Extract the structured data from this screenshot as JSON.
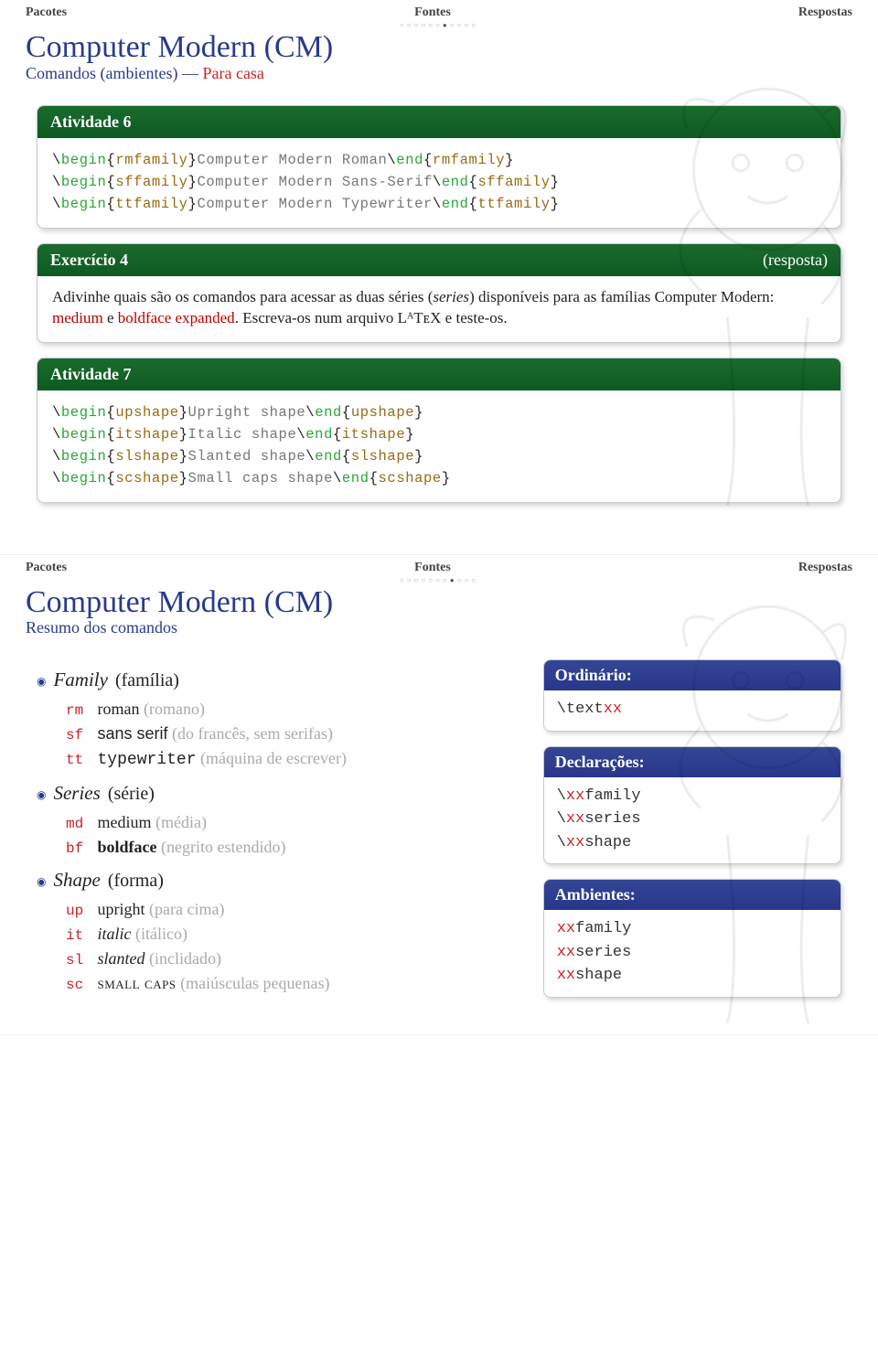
{
  "nav": {
    "left": "Pacotes",
    "center": "Fontes",
    "right": "Respostas"
  },
  "slide1": {
    "progress_index": 6,
    "progress_total": 11,
    "title": "Computer Modern (CM)",
    "subtitle_a": "Comandos (ambientes) — ",
    "subtitle_b": "Para casa",
    "box1": {
      "head": "Atividade 6",
      "lines": [
        {
          "pre": "\\",
          "kw": "begin",
          "env": "rmfamily",
          "mid": "Computer Modern Roman",
          "post_kw": "end",
          "post_env": "rmfamily"
        },
        {
          "pre": "\\",
          "kw": "begin",
          "env": "sffamily",
          "mid": "Computer Modern Sans-Serif",
          "post_kw": "end",
          "post_env": "sffamily"
        },
        {
          "pre": "\\",
          "kw": "begin",
          "env": "ttfamily",
          "mid": "Computer Modern Typewriter",
          "post_kw": "end",
          "post_env": "ttfamily"
        }
      ]
    },
    "box2": {
      "head_left": "Exercício 4",
      "head_right": "(resposta)",
      "body_a": "Adivinhe quais são os comandos para acessar as duas séries (",
      "body_b": "series",
      "body_c": ") disponíveis para as famílias Computer Modern: ",
      "body_d": "medium",
      "body_e": " e ",
      "body_f": "boldface expanded",
      "body_g": ". Escreva-os num arquivo LᴬTᴇX e teste-os."
    },
    "box3": {
      "head": "Atividade 7",
      "lines": [
        {
          "kw": "begin",
          "env": "upshape",
          "mid": "Upright shape",
          "post_kw": "end",
          "post_env": "upshape"
        },
        {
          "kw": "begin",
          "env": "itshape",
          "mid": "Italic shape",
          "post_kw": "end",
          "post_env": "itshape"
        },
        {
          "kw": "begin",
          "env": "slshape",
          "mid": "Slanted shape",
          "post_kw": "end",
          "post_env": "slshape"
        },
        {
          "kw": "begin",
          "env": "scshape",
          "mid": "Small caps shape",
          "post_kw": "end",
          "post_env": "scshape"
        }
      ]
    }
  },
  "slide2": {
    "progress_index": 7,
    "progress_total": 11,
    "title": "Computer Modern (CM)",
    "subtitle": "Resumo dos comandos",
    "groups": [
      {
        "label": "Family",
        "label_pt": "(família)",
        "items": [
          {
            "tag": "rm",
            "text": "roman",
            "note": "(romano)",
            "cls": ""
          },
          {
            "tag": "sf",
            "text": "sans serif",
            "note": "(do francês, sem serifas)",
            "cls": "sf"
          },
          {
            "tag": "tt",
            "text": "typewriter",
            "note": "(máquina de escrever)",
            "cls": "tt"
          }
        ]
      },
      {
        "label": "Series",
        "label_pt": "(série)",
        "items": [
          {
            "tag": "md",
            "text": "medium",
            "note": "(média)",
            "cls": ""
          },
          {
            "tag": "bf",
            "text": "boldface",
            "note": "(negrito estendido)",
            "cls": "bf"
          }
        ]
      },
      {
        "label": "Shape",
        "label_pt": "(forma)",
        "items": [
          {
            "tag": "up",
            "text": "upright",
            "note": "(para cima)",
            "cls": ""
          },
          {
            "tag": "it",
            "text": "italic",
            "note": "(itálico)",
            "cls": "ital"
          },
          {
            "tag": "sl",
            "text": "slanted",
            "note": "(inclidado)",
            "cls": "sl"
          },
          {
            "tag": "sc",
            "text": "small caps",
            "note": "(maiúsculas pequenas)",
            "cls": "sc"
          }
        ]
      }
    ],
    "side": [
      {
        "head": "Ordinário:",
        "lines": [
          [
            "\\text",
            "xx"
          ]
        ]
      },
      {
        "head": "Declarações:",
        "lines": [
          [
            "\\",
            "xx",
            "family"
          ],
          [
            "\\",
            "xx",
            "series"
          ],
          [
            "\\",
            "xx",
            "shape"
          ]
        ]
      },
      {
        "head": "Ambientes:",
        "lines": [
          [
            "",
            "xx",
            "family"
          ],
          [
            "",
            "xx",
            "series"
          ],
          [
            "",
            "xx",
            "shape"
          ]
        ]
      }
    ]
  }
}
